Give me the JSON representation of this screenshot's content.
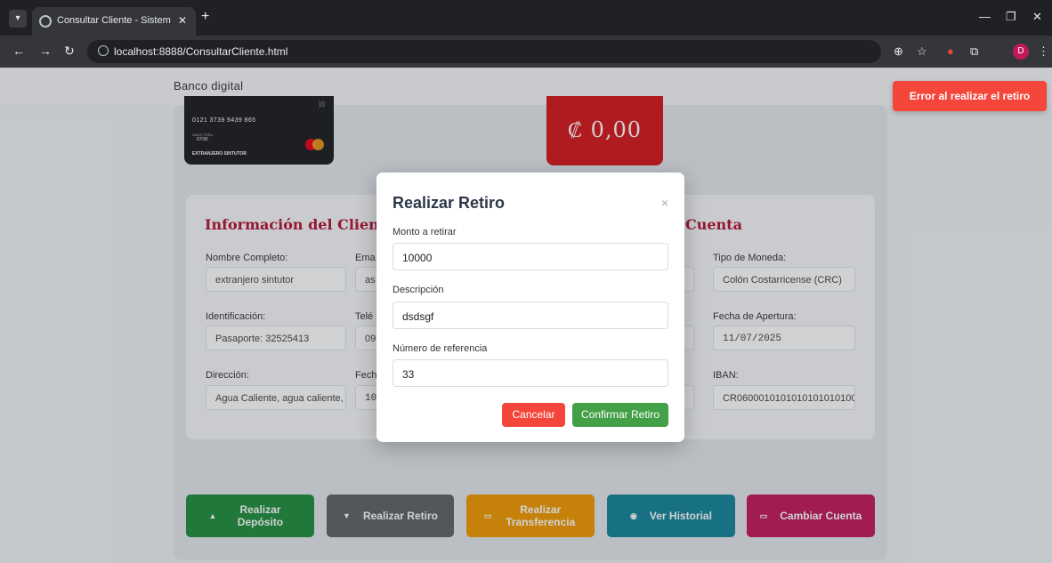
{
  "browser": {
    "tab_title": "Consultar Cliente - Sistema Ban",
    "url": "localhost:8888/ConsultarCliente.html",
    "profile_initial": "D"
  },
  "page": {
    "brand": "Banco digital",
    "card": {
      "number": "0121 3739 9439 865",
      "valid_label": "VALID THRU",
      "expiry": "07/30",
      "holder": "EXTRANJERO SINTUTOR"
    },
    "balance": "₡ 0,00",
    "client_section_title": "Información del Cliente",
    "account_section_title": "Cuenta",
    "client_fields": {
      "full_name": {
        "label": "Nombre Completo:",
        "value": "extranjero sintutor"
      },
      "email": {
        "label": "Ema",
        "value": "as"
      },
      "identification": {
        "label": "Identificación:",
        "value": "Pasaporte: 32525413"
      },
      "phone": {
        "label": "Telé",
        "value": "09"
      },
      "address": {
        "label": "Dirección:",
        "value": "Agua Caliente, agua caliente, c"
      },
      "date": {
        "label": "Fech",
        "value": "10"
      }
    },
    "account_fields": {
      "currency": {
        "label": "Tipo de Moneda:",
        "value": "Colón Costarricense (CRC)"
      },
      "opening_date": {
        "label": "Fecha de Apertura:",
        "value": "11/07/2025"
      },
      "iban": {
        "label": "IBAN:",
        "value": "CR0600010101010101010100"
      }
    },
    "actions": [
      {
        "label": "Realizar Depósito",
        "color": "#1e8e3e"
      },
      {
        "label": "Realizar Retiro",
        "color": "#5f6368"
      },
      {
        "label": "Realizar Transferencia",
        "color": "#f29900"
      },
      {
        "label": "Ver Historial",
        "color": "#12859a"
      },
      {
        "label": "Cambiar Cuenta",
        "color": "#c2185b"
      }
    ]
  },
  "toast": {
    "message": "Error al realizar el retiro",
    "color": "#f4463b"
  },
  "modal": {
    "title": "Realizar Retiro",
    "close": "×",
    "amount": {
      "label": "Monto a retirar",
      "value": "10000"
    },
    "description": {
      "label": "Descripción",
      "value": "dsdsgf"
    },
    "reference": {
      "label": "Número de referencia",
      "value": "33"
    },
    "cancel_label": "Cancelar",
    "confirm_label": "Confirmar Retiro"
  }
}
